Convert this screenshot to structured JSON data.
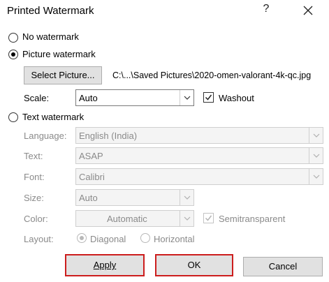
{
  "window": {
    "title": "Printed Watermark",
    "help_glyph": "?"
  },
  "options": {
    "no_watermark": "No watermark",
    "picture_watermark": "Picture watermark",
    "text_watermark": "Text watermark"
  },
  "picture": {
    "select_button": "Select Picture...",
    "path": "C:\\...\\Saved Pictures\\2020-omen-valorant-4k-qc.jpg",
    "scale_label": "Scale:",
    "scale_value": "Auto",
    "washout_label": "Washout",
    "washout_checked": true
  },
  "text": {
    "language_label": "Language:",
    "language_value": "English (India)",
    "text_label": "Text:",
    "text_value": "ASAP",
    "font_label": "Font:",
    "font_value": "Calibri",
    "size_label": "Size:",
    "size_value": "Auto",
    "color_label": "Color:",
    "color_value": "Automatic",
    "semitransparent_label": "Semitransparent",
    "semitransparent_checked": true,
    "layout_label": "Layout:",
    "layout_diagonal": "Diagonal",
    "layout_horizontal": "Horizontal"
  },
  "buttons": {
    "apply": "Apply",
    "ok": "OK",
    "cancel": "Cancel"
  },
  "colors": {
    "highlight_border": "#cc1d1d",
    "button_face": "#e1e1e1",
    "disabled_text": "#8a8a8a"
  }
}
